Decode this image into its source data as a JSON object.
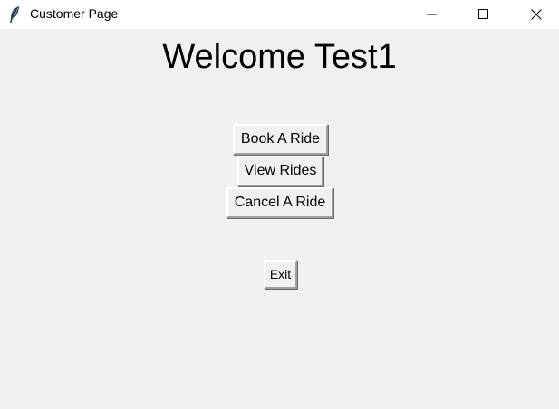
{
  "window": {
    "title": "Customer Page",
    "icon": "feather-icon",
    "controls": [
      "minimize-icon",
      "maximize-icon",
      "close-icon"
    ]
  },
  "main": {
    "heading": "Welcome Test1",
    "buttons": {
      "book": "Book A Ride",
      "view": "View Rides",
      "cancel": "Cancel A Ride",
      "exit": "Exit"
    }
  },
  "colors": {
    "background": "#f0f0f0",
    "titlebar": "#ffffff",
    "text": "#000000"
  }
}
